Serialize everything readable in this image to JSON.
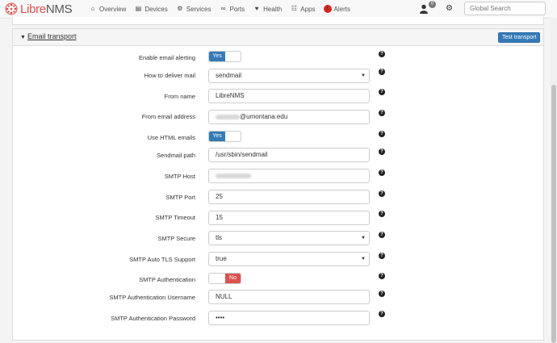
{
  "navbar": {
    "brand": {
      "libre": "Libre",
      "nms": "NMS"
    },
    "items": [
      {
        "label": "Overview",
        "icon": "home-icon"
      },
      {
        "label": "Devices",
        "icon": "server-icon"
      },
      {
        "label": "Services",
        "icon": "cogs-icon"
      },
      {
        "label": "Ports",
        "icon": "link-icon"
      },
      {
        "label": "Health",
        "icon": "heartbeat-icon"
      },
      {
        "label": "Apps",
        "icon": "tasks-icon"
      },
      {
        "label": "Alerts",
        "icon": "exclamation-circle-icon"
      }
    ],
    "user_badge": "0",
    "search_placeholder": "Global Search"
  },
  "panel": {
    "title": "Email transport",
    "test_button": "Test transport",
    "settings": {
      "enable_alerting": {
        "label": "Enable email alerting",
        "toggle": "Yes"
      },
      "deliver": {
        "label": "How to deliver mail",
        "value": "sendmail"
      },
      "from_name": {
        "label": "From name",
        "value": "LibreNMS"
      },
      "from_email": {
        "label": "From email address",
        "value": "@umontana.edu"
      },
      "use_html": {
        "label": "Use HTML emails",
        "toggle": "Yes"
      },
      "sendmail_path": {
        "label": "Sendmail path",
        "value": "/usr/sbin/sendmail"
      },
      "smtp_host": {
        "label": "SMTP Host",
        "value": ""
      },
      "smtp_port": {
        "label": "SMTP Port",
        "value": "25"
      },
      "smtp_timeout": {
        "label": "SMTP Timeout",
        "value": "15"
      },
      "smtp_secure": {
        "label": "SMTP Secure",
        "value": "tls"
      },
      "smtp_autotls": {
        "label": "SMTP Auto TLS Support",
        "value": "true"
      },
      "smtp_auth": {
        "label": "SMTP Authentication",
        "toggle": "No"
      },
      "smtp_username": {
        "label": "SMTP Authentication Username",
        "value": "NULL"
      },
      "smtp_password": {
        "label": "SMTP Authentication Password",
        "value": "••••"
      }
    },
    "help_glyph": "?"
  }
}
